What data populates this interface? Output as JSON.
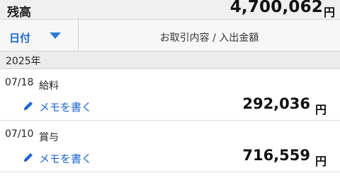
{
  "balance": {
    "label": "残高",
    "amount": "4,700,062",
    "unit": "円"
  },
  "header": {
    "sort_label": "日付",
    "sort_icon": "triangle-down-icon",
    "column_title": "お取引内容 / 入出金額"
  },
  "year_label": "2025年",
  "transactions": [
    {
      "date": "07/18",
      "description": "給料",
      "memo_label": "メモを書く",
      "amount": "292,036",
      "unit": "円"
    },
    {
      "date": "07/10",
      "description": "賞与",
      "memo_label": "メモを書く",
      "amount": "716,559",
      "unit": "円"
    }
  ],
  "colors": {
    "accent": "#1a66cc",
    "header_bg": "#f7f7f7",
    "section_bg": "#ececec"
  }
}
